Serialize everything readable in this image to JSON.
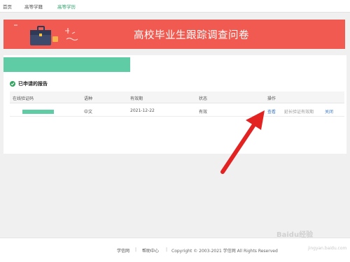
{
  "nav": {
    "items": [
      "首页",
      "高等学籍",
      "高等学历"
    ],
    "active_index": 2
  },
  "banner": {
    "title": "高校毕业生跟踪调查问卷",
    "background_color": "#f05a50"
  },
  "section": {
    "title": "已申请的报告"
  },
  "table": {
    "headers": [
      "在线验证码",
      "语种",
      "有效期",
      "状态",
      "操作"
    ],
    "rows": [
      {
        "language": "中文",
        "expiry": "2021-12-22",
        "status": "有效",
        "actions": [
          "查看",
          "延长验证有效期",
          "关闭"
        ]
      }
    ]
  },
  "footer": {
    "links": [
      "学信网",
      "帮助中心"
    ],
    "separator": "|",
    "copyright": "Copyright © 2003-2021 学信网 All Rights Reserved"
  },
  "watermark": {
    "text": "Baidu经验",
    "url": "jingyan.baidu.com"
  },
  "colors": {
    "accent_green": "#5fcca5",
    "link_blue": "#3a78c3",
    "arrow_red": "#e32222"
  }
}
